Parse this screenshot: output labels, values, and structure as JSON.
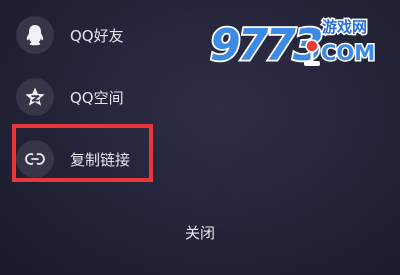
{
  "share_menu": {
    "items": [
      {
        "label": "QQ好友",
        "icon": "qq-penguin-icon"
      },
      {
        "label": "QQ空间",
        "icon": "qzone-star-icon"
      },
      {
        "label": "复制链接",
        "icon": "link-icon"
      }
    ],
    "close_label": "关闭",
    "highlight_color": "#e8363a"
  },
  "watermark": {
    "brand": "9773",
    "tagline": "游戏网",
    "suffix": "COM"
  }
}
